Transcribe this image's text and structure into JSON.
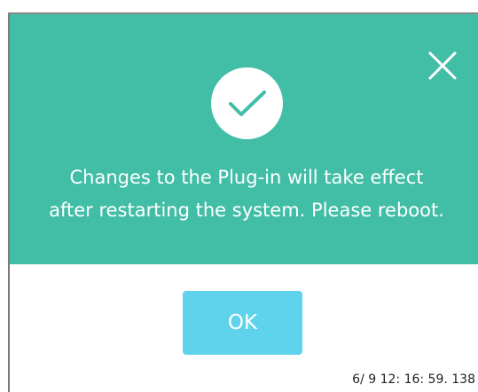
{
  "dialog": {
    "close_icon": "close-icon",
    "status_icon": "checkmark-icon",
    "message_line1": "Changes to the Plug-in will take effect",
    "message_line2": "after restarting the system. Please reboot.",
    "ok_label": "OK",
    "timestamp": "6/ 9 12: 16: 59. 138"
  },
  "colors": {
    "header_background": "#42bea6",
    "ok_button_background": "#5fd2ec",
    "text_on_header": "#ffffff"
  }
}
